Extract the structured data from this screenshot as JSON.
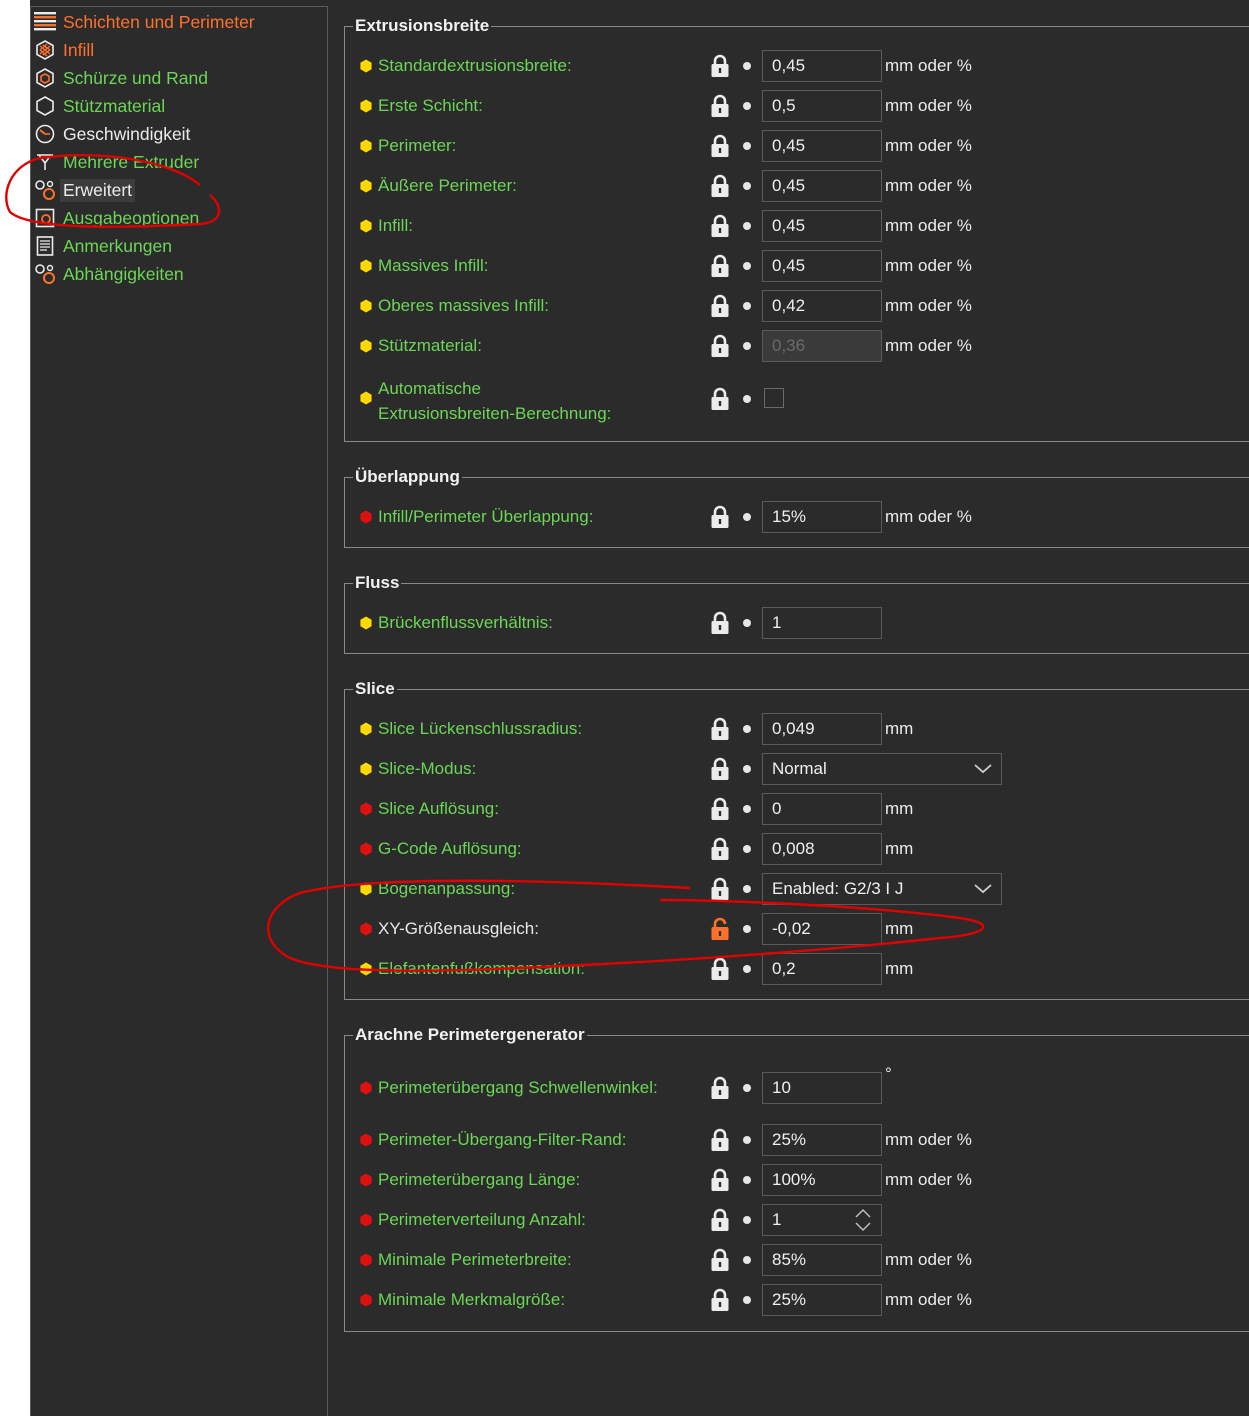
{
  "sidebar": {
    "items": [
      {
        "label": "Schichten und Perimeter",
        "color": "orange",
        "icon": "layers-icon",
        "selected": false
      },
      {
        "label": "Infill",
        "color": "orange",
        "icon": "infill-icon",
        "selected": false
      },
      {
        "label": "Schürze und Rand",
        "color": "green",
        "icon": "skirt-brim-icon",
        "selected": false
      },
      {
        "label": "Stützmaterial",
        "color": "green",
        "icon": "support-icon",
        "selected": false
      },
      {
        "label": "Geschwindigkeit",
        "color": "white",
        "icon": "speed-gauge-icon",
        "selected": false
      },
      {
        "label": "Mehrere Extruder",
        "color": "green",
        "icon": "multi-extruder-icon",
        "selected": false
      },
      {
        "label": "Erweitert",
        "color": "white",
        "icon": "advanced-gears-icon",
        "selected": true
      },
      {
        "label": "Ausgabeoptionen",
        "color": "green",
        "icon": "output-options-icon",
        "selected": false
      },
      {
        "label": "Anmerkungen",
        "color": "green",
        "icon": "notes-icon",
        "selected": false
      },
      {
        "label": "Abhängigkeiten",
        "color": "green",
        "icon": "dependencies-gears-icon",
        "selected": false
      }
    ]
  },
  "colors": {
    "orange": "#ff7128",
    "green": "#6cd656",
    "yellow_marker": "#ffd800",
    "red_marker": "#e01010",
    "annotation": "#e00000"
  },
  "groups": {
    "extrusion": {
      "title": "Extrusionsbreite",
      "rows": [
        {
          "label": "Standardextrusionsbreite:",
          "marker": "yellow",
          "value": "0,45",
          "unit": "mm oder %"
        },
        {
          "label": "Erste Schicht:",
          "marker": "yellow",
          "value": "0,5",
          "unit": "mm oder %"
        },
        {
          "label": "Perimeter:",
          "marker": "yellow",
          "value": "0,45",
          "unit": "mm oder %"
        },
        {
          "label": "Äußere Perimeter:",
          "marker": "yellow",
          "value": "0,45",
          "unit": "mm oder %"
        },
        {
          "label": "Infill:",
          "marker": "yellow",
          "value": "0,45",
          "unit": "mm oder %"
        },
        {
          "label": "Massives Infill:",
          "marker": "yellow",
          "value": "0,45",
          "unit": "mm oder %"
        },
        {
          "label": "Oberes massives Infill:",
          "marker": "yellow",
          "value": "0,42",
          "unit": "mm oder %"
        },
        {
          "label": "Stützmaterial:",
          "marker": "yellow",
          "value": "0,36",
          "unit": "mm oder %",
          "disabled": true
        }
      ],
      "auto_label_line1": "Automatische",
      "auto_label_line2": "Extrusionsbreiten-Berechnung:"
    },
    "overlap": {
      "title": "Überlappung",
      "rows": [
        {
          "label": "Infill/Perimeter Überlappung:",
          "marker": "red",
          "value": "15%",
          "unit": "mm oder %"
        }
      ]
    },
    "flow": {
      "title": "Fluss",
      "rows": [
        {
          "label": "Brückenflussverhältnis:",
          "marker": "yellow",
          "value": "1",
          "unit": ""
        }
      ]
    },
    "slice": {
      "title": "Slice",
      "rows": [
        {
          "label": "Slice Lückenschlussradius:",
          "marker": "yellow",
          "value": "0,049",
          "unit": "mm"
        },
        {
          "label": "Slice-Modus:",
          "marker": "yellow",
          "value": "Normal",
          "unit": "",
          "dropdown": true
        },
        {
          "label": "Slice Auflösung:",
          "marker": "red",
          "value": "0",
          "unit": "mm"
        },
        {
          "label": "G-Code Auflösung:",
          "marker": "red",
          "value": "0,008",
          "unit": "mm"
        },
        {
          "label": "Bogenanpassung:",
          "marker": "yellow",
          "value": "Enabled: G2/3 I J",
          "unit": "",
          "dropdown": true
        },
        {
          "label": "XY-Größenausgleich:",
          "marker": "red",
          "value": "-0,02",
          "unit": "mm",
          "unlocked": true,
          "dark": true
        },
        {
          "label": "Elefantenfußkompensation:",
          "marker": "yellow",
          "value": "0,2",
          "unit": "mm"
        }
      ]
    },
    "arachne": {
      "title": "Arachne Perimetergenerator",
      "rows": [
        {
          "label": "Perimeterübergang Schwellenwinkel:",
          "marker": "red",
          "value": "10",
          "unit": "°"
        },
        {
          "label": "Perimeter-Übergang-Filter-Rand:",
          "marker": "red",
          "value": "25%",
          "unit": "mm oder %"
        },
        {
          "label": "Perimeterübergang Länge:",
          "marker": "red",
          "value": "100%",
          "unit": "mm oder %"
        },
        {
          "label": "Perimeterverteilung Anzahl:",
          "marker": "red",
          "value": "1",
          "unit": "",
          "spin": true
        },
        {
          "label": "Minimale Perimeterbreite:",
          "marker": "red",
          "value": "85%",
          "unit": "mm oder %"
        },
        {
          "label": "Minimale Merkmalgröße:",
          "marker": "red",
          "value": "25%",
          "unit": "mm oder %"
        }
      ]
    }
  }
}
